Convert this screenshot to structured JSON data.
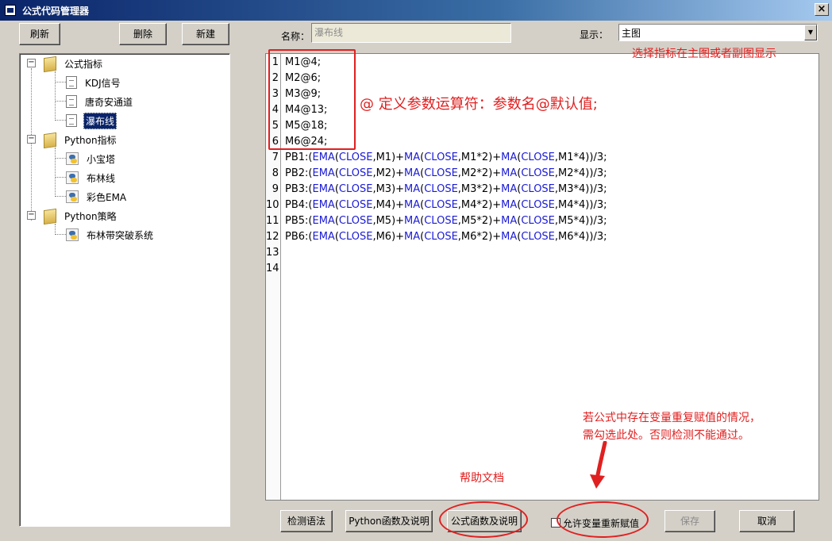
{
  "window": {
    "title": "公式代码管理器",
    "close_glyph": "×"
  },
  "toolbar": {
    "refresh": "刷新",
    "delete": "删除",
    "new": "新建"
  },
  "tree": {
    "groups": [
      {
        "label": "公式指标",
        "items": [
          "KDJ信号",
          "唐奇安通道",
          "瀑布线"
        ]
      },
      {
        "label": "Python指标",
        "items": [
          "小宝塔",
          "布林线",
          "彩色EMA"
        ]
      },
      {
        "label": "Python策略",
        "items": [
          "布林带突破系统"
        ]
      }
    ],
    "selected": "瀑布线",
    "expander_glyph": "−"
  },
  "form": {
    "name_label": "名称：",
    "name_value": "瀑布线",
    "display_label": "显示：",
    "display_value": "主图",
    "combo_arrow": "▼"
  },
  "editor": {
    "line_numbers": [
      "1",
      "2",
      "3",
      "4",
      "5",
      "6",
      "7",
      "8",
      "9",
      "10",
      "11",
      "12",
      "13",
      "14"
    ],
    "lines": [
      "M1@4;",
      "M2@6;",
      "M3@9;",
      "M4@13;",
      "M5@18;",
      "M6@24;",
      "PB1:(EMA(CLOSE,M1)+MA(CLOSE,M1*2)+MA(CLOSE,M1*4))/3;",
      "PB2:(EMA(CLOSE,M2)+MA(CLOSE,M2*2)+MA(CLOSE,M2*4))/3;",
      "PB3:(EMA(CLOSE,M3)+MA(CLOSE,M3*2)+MA(CLOSE,M3*4))/3;",
      "PB4:(EMA(CLOSE,M4)+MA(CLOSE,M4*2)+MA(CLOSE,M4*4))/3;",
      "PB5:(EMA(CLOSE,M5)+MA(CLOSE,M5*2)+MA(CLOSE,M5*4))/3;",
      "PB6:(EMA(CLOSE,M6)+MA(CLOSE,M6*2)+MA(CLOSE,M6*4))/3;"
    ],
    "keywords": [
      "EMA",
      "MA",
      "CLOSE"
    ],
    "keyword_color": "#1a1ad6"
  },
  "annotations": {
    "display_hint": "选择指标在主图或者副图显示",
    "param_hint": "@ 定义参数运算符：参数名@默认值;",
    "reassign_hint_1": "若公式中存在变量重复赋值的情况，",
    "reassign_hint_2": "需勾选此处。否则检测不能通过。",
    "help_hint": "帮助文档",
    "color": "#e02020"
  },
  "bottom": {
    "check_syntax": "检测语法",
    "python_funcs": "Python函数及说明",
    "formula_funcs": "公式函数及说明",
    "allow_reassign": "允许变量重新赋值",
    "save": "保存",
    "cancel": "取消"
  }
}
